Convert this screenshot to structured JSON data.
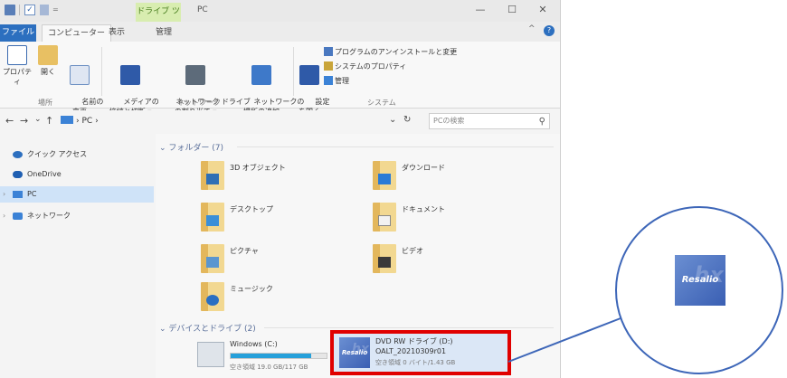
{
  "window": {
    "context_tab": "ドライブ ツール",
    "title": "PC",
    "minimize": "—",
    "maximize": "☐",
    "close": "✕",
    "collapse": "^",
    "help": "?"
  },
  "menu": {
    "tabs": [
      {
        "label": "ファイル"
      },
      {
        "label": "コンピューター"
      },
      {
        "label": "表示"
      },
      {
        "label": "管理"
      }
    ]
  },
  "ribbon": {
    "location": {
      "group_label": "場所",
      "buttons": [
        {
          "label": "プロパティ",
          "icon": "properties-icon"
        },
        {
          "label": "開く",
          "icon": "open-icon"
        },
        {
          "label": "名前の\n変更",
          "icon": "rename-icon"
        }
      ]
    },
    "network": {
      "group_label": "ネットワーク",
      "buttons": [
        {
          "label": "メディアの\n接続と切断 ▾",
          "icon": "media-icon"
        },
        {
          "label": "ネットワーク ドライブ\nの割り当て ▾",
          "icon": "map-drive-icon"
        },
        {
          "label": "ネットワークの\n場所の追加",
          "icon": "add-location-icon"
        }
      ]
    },
    "system": {
      "group_label": "システム",
      "settings_label": "設定\nを開く",
      "small_items": [
        {
          "label": "プログラムのアンインストールと変更"
        },
        {
          "label": "システムのプロパティ"
        },
        {
          "label": "管理"
        }
      ]
    }
  },
  "address": {
    "back": "←",
    "forward": "→",
    "down": "⌄",
    "up": "↑",
    "crumb_sep": "›",
    "crumb": "PC",
    "crumb_tail": "›",
    "dropdown": "⌄",
    "refresh": "↻",
    "search_placeholder": "PCの検索",
    "search_icon": "⚲"
  },
  "nav_pane": {
    "items": [
      {
        "label": "クイック アクセス",
        "icon": "star-icon",
        "color": "#2c6fbf"
      },
      {
        "label": "OneDrive",
        "icon": "cloud-icon",
        "color": "#1f5fb2"
      },
      {
        "label": "PC",
        "icon": "pc-icon",
        "color": "#3b82d6",
        "selected": true
      },
      {
        "label": "ネットワーク",
        "icon": "network-icon",
        "color": "#3b82d6"
      }
    ]
  },
  "content": {
    "folders_header": "フォルダー (7)",
    "folders": [
      {
        "label": "3D オブジェクト",
        "icon": "3d-objects-icon"
      },
      {
        "label": "ダウンロード",
        "icon": "downloads-icon"
      },
      {
        "label": "デスクトップ",
        "icon": "desktop-icon"
      },
      {
        "label": "ドキュメント",
        "icon": "documents-icon"
      },
      {
        "label": "ピクチャ",
        "icon": "pictures-icon"
      },
      {
        "label": "ビデオ",
        "icon": "videos-icon"
      },
      {
        "label": "ミュージック",
        "icon": "music-icon"
      }
    ],
    "devices_header": "デバイスとドライブ (2)",
    "drives": [
      {
        "name": "Windows (C:)",
        "free": "空き領域 19.0 GB/117 GB",
        "used_fraction": 0.84
      },
      {
        "name": "DVD RW ドライブ (D:)",
        "volume": "OALT_20210309r01",
        "free": "空き領域 0 バイト/1.43 GB",
        "logo": "Resalio",
        "logo_mark": "hx"
      }
    ]
  },
  "callout": {
    "logo": "Resalio",
    "logo_mark": "hx"
  },
  "colors": {
    "accent": "#2c6fbf",
    "highlight": "#e00000",
    "callout_border": "#3d66b8"
  }
}
